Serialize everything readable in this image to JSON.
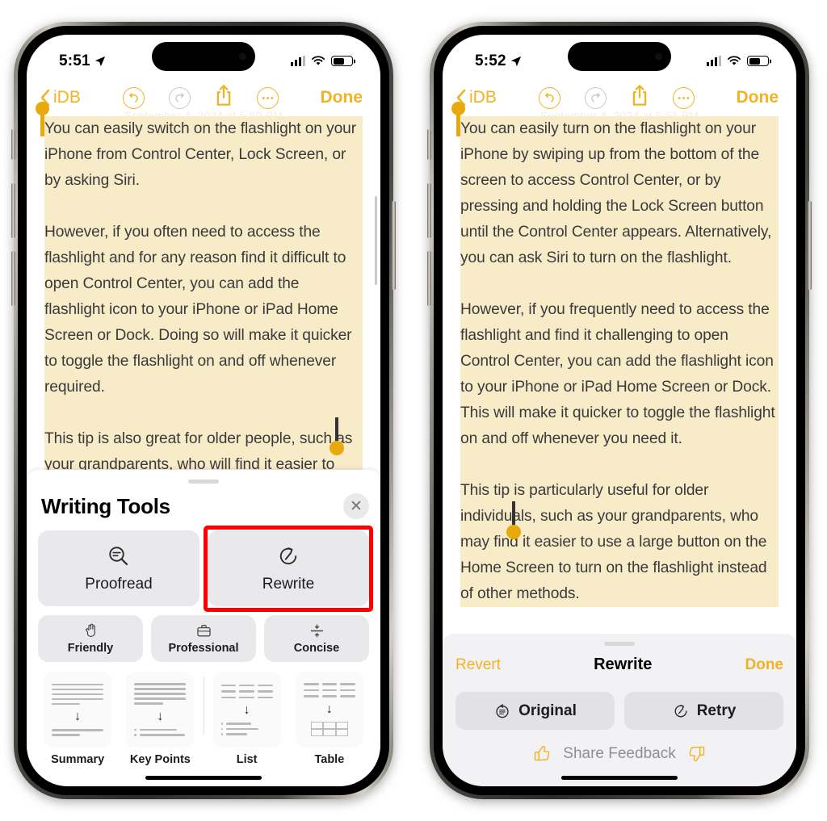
{
  "phones": [
    {
      "id": "left",
      "status": {
        "time": "5:51",
        "location_icon": "location-arrow-icon",
        "signal_icon": "cellular-bars-icon",
        "wifi_icon": "wifi-icon",
        "battery_icon": "battery-icon"
      },
      "nav": {
        "back_label": "iDB",
        "back_icon": "chevron-left-icon",
        "undo_icon": "undo-icon",
        "redo_icon": "redo-icon",
        "share_icon": "share-icon",
        "more_icon": "ellipsis-icon",
        "done_label": "Done"
      },
      "note": {
        "date": "September 4, 2024 at 5:50 PM",
        "paragraphs": [
          "You can easily switch on the flashlight on your iPhone from Control Center, Lock Screen, or by asking Siri.",
          "However, if you often need to access the flashlight and for any reason find it difficult to open Control Center, you can add the flashlight icon to your iPhone or iPad Home Screen or Dock. Doing so will make it quicker to toggle the flashlight on and off whenever required.",
          "This tip is also great for older people, such as your grandparents, who will find it easier to turn on the flashlight using a massive button on the Home Screen, as opposed to other methods."
        ]
      }
    },
    {
      "id": "right",
      "status": {
        "time": "5:52",
        "location_icon": "location-arrow-icon",
        "signal_icon": "cellular-bars-icon",
        "wifi_icon": "wifi-icon",
        "battery_icon": "battery-icon"
      },
      "nav": {
        "back_label": "iDB",
        "back_icon": "chevron-left-icon",
        "undo_icon": "undo-icon",
        "redo_icon": "redo-icon",
        "share_icon": "share-icon",
        "more_icon": "ellipsis-icon",
        "done_label": "Done"
      },
      "note": {
        "date": "September 4, 2024 at 5:51 PM",
        "paragraphs": [
          "You can easily turn on the flashlight on your iPhone by swiping up from the bottom of the screen to access Control Center, or by pressing and holding the Lock Screen button until the Control Center appears. Alternatively, you can ask Siri to turn on the flashlight.",
          "However, if you frequently need to access the flashlight and find it challenging to open Control Center, you can add the flashlight icon to your iPhone or iPad Home Screen or Dock. This will make it quicker to toggle the flashlight on and off whenever you need it.",
          "This tip is particularly useful for older individuals, such as your grandparents, who may find it easier to use a large button on the Home Screen to turn on the flashlight instead of other methods."
        ]
      }
    }
  ],
  "writing_tools": {
    "title": "Writing Tools",
    "close_icon": "close-icon",
    "primary_actions": [
      {
        "label": "Proofread",
        "icon": "magnifier-lines-icon",
        "highlighted": false
      },
      {
        "label": "Rewrite",
        "icon": "rewrite-clock-icon",
        "highlighted": true
      }
    ],
    "tone_actions": [
      {
        "label": "Friendly",
        "icon": "wave-hand-icon"
      },
      {
        "label": "Professional",
        "icon": "briefcase-icon"
      },
      {
        "label": "Concise",
        "icon": "compress-icon"
      }
    ],
    "format_actions": [
      {
        "label": "Summary",
        "icon": "summary-icon"
      },
      {
        "label": "Key Points",
        "icon": "key-points-icon"
      },
      {
        "label": "List",
        "icon": "list-icon"
      },
      {
        "label": "Table",
        "icon": "table-icon"
      }
    ],
    "highlight_color": "#FF0000"
  },
  "rewrite_bar": {
    "revert_label": "Revert",
    "title": "Rewrite",
    "done_label": "Done",
    "buttons": [
      {
        "label": "Original",
        "icon": "original-doc-icon"
      },
      {
        "label": "Retry",
        "icon": "retry-clock-icon"
      }
    ],
    "feedback_label": "Share Feedback",
    "thumbs_up_icon": "thumbs-up-icon",
    "thumbs_down_icon": "thumbs-down-icon"
  },
  "colors": {
    "accent_yellow": "#F0B323",
    "selection_handle": "#E8A90C",
    "text_highlight": "#F8EBC8",
    "body_text": "#3A3A3C",
    "card_gray": "#E9E9EB",
    "sheet_gray": "#F2F2F4",
    "red_annotation": "#FF0000"
  }
}
